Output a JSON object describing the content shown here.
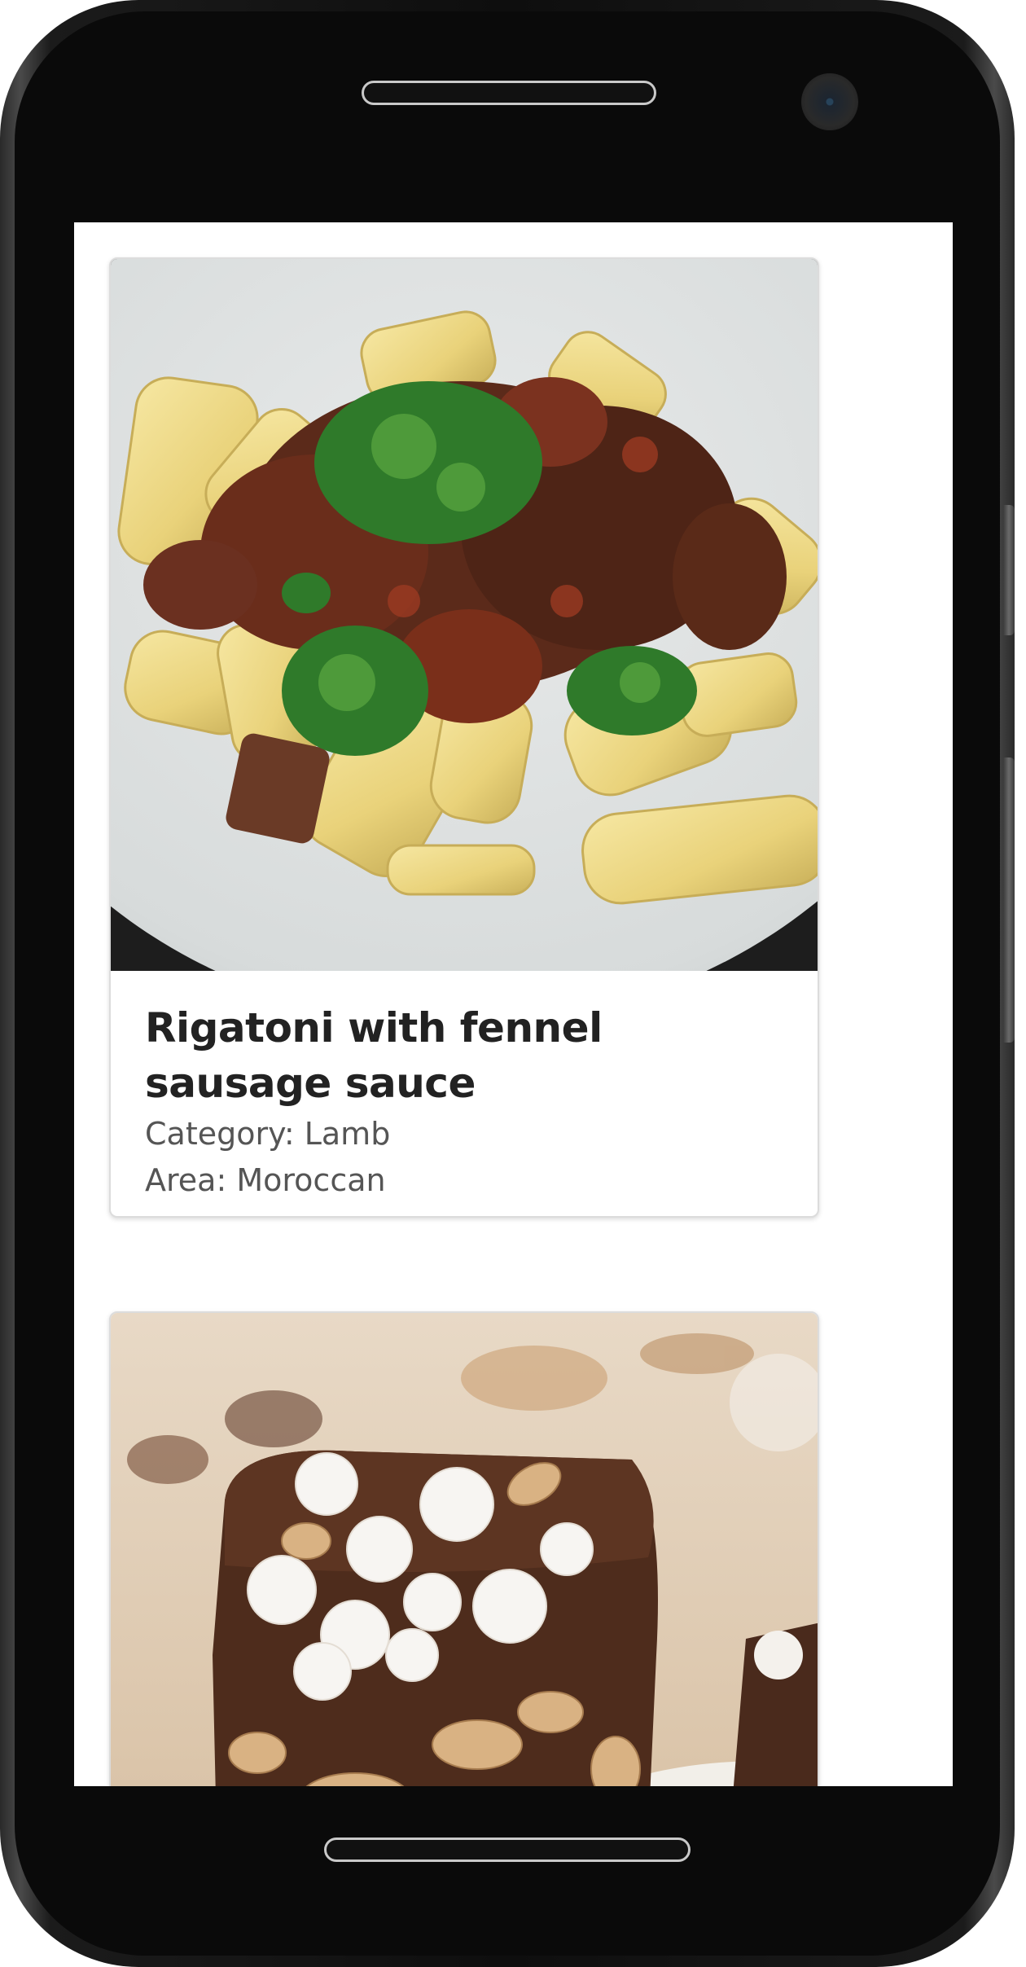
{
  "recipes": [
    {
      "title": "Rigatoni with fennel sausage sauce",
      "category_label": "Category:",
      "category": "Lamb",
      "area_label": "Area:",
      "area": "Moroccan",
      "image": "pasta-photo"
    },
    {
      "image": "rocky-road-photo"
    }
  ],
  "colors": {
    "frame": "#0a0a0a",
    "screen_bg": "#ffffff",
    "title_text": "#222222",
    "meta_text": "#555555",
    "card_border": "#dcdcdc"
  }
}
